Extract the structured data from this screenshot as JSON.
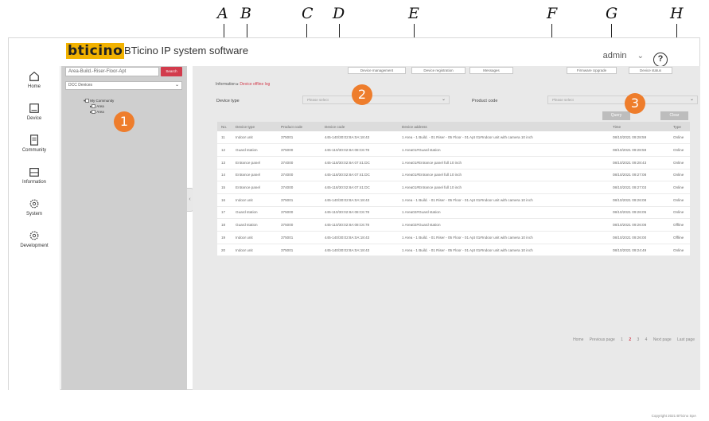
{
  "callouts": {
    "letters": [
      "A",
      "B",
      "C",
      "D",
      "E",
      "F",
      "G",
      "H"
    ],
    "badges": [
      "1",
      "2",
      "3"
    ]
  },
  "header": {
    "logo": "bticino",
    "app_title": "BTicino IP system software",
    "user": "admin",
    "help": "?"
  },
  "nav": [
    {
      "label": "Home",
      "icon": "home-icon"
    },
    {
      "label": "Device",
      "icon": "device-icon"
    },
    {
      "label": "Community",
      "icon": "community-icon"
    },
    {
      "label": "Information",
      "icon": "information-icon"
    },
    {
      "label": "System",
      "icon": "gear-icon"
    },
    {
      "label": "Development",
      "icon": "gear-icon"
    }
  ],
  "tree": {
    "search_placeholder": "Area-Build.-Riser-Floor-Apt",
    "search_button": "Search",
    "filter_value": "DCC Devices",
    "root": "My Community",
    "children": [
      "Area",
      "Area"
    ]
  },
  "toolbar": {
    "buttons": [
      "Device management",
      "Device registration",
      "Messages",
      "Firmware Upgrade",
      "Device status"
    ]
  },
  "breadcrumb": {
    "parent": "Information",
    "current": "Device offline log"
  },
  "filters": {
    "device_type_label": "Device type",
    "device_type_placeholder": "Please select",
    "product_code_label": "Product code",
    "product_code_placeholder": "Please select",
    "query_button": "Query",
    "clear_button": "Clear"
  },
  "table": {
    "columns": [
      "No.",
      "Device type",
      "Product code",
      "Device code",
      "Device address",
      "Time",
      "Type"
    ],
    "rows": [
      [
        "11",
        "Indoor unit",
        "375001",
        "445-140/30:02:8A:0A:18:43",
        "1 Area - 1 Build. - 01 Riser - 05 Floor - 01 Apt 01#Indoor unit with camera 10 inch",
        "08/10/2021 09:28:59",
        "Online"
      ],
      [
        "12",
        "Guard station",
        "375000",
        "445-110/30:02:8A:08:C6:78",
        "1 Area01#Guard station",
        "08/10/2021 09:28:59",
        "Online"
      ],
      [
        "13",
        "Entrance panel",
        "374000",
        "445-118/30:02:8A:07:41:DC",
        "1 Area01#Entrance panel full 10 inch",
        "08/10/2021 09:28:43",
        "Online"
      ],
      [
        "14",
        "Entrance panel",
        "374000",
        "445-118/30:02:8A:07:41:DC",
        "1 Area01#Entrance panel full 10 inch",
        "08/10/2021 09:27:08",
        "Online"
      ],
      [
        "15",
        "Entrance panel",
        "374000",
        "445-118/30:02:8A:07:41:DC",
        "1 Area01#Entrance panel full 10 inch",
        "08/10/2021 09:27:03",
        "Online"
      ],
      [
        "16",
        "Indoor unit",
        "375001",
        "445-140/30:02:8A:0A:18:43",
        "1 Area - 1 Build. - 01 Riser - 05 Floor - 01 Apt 01#Indoor unit with camera 10 inch",
        "08/10/2021 09:26:08",
        "Online"
      ],
      [
        "17",
        "Guard station",
        "375000",
        "445-110/30:02:8A:08:C6:78",
        "1 Area02#Guard station",
        "08/10/2021 09:26:05",
        "Online"
      ],
      [
        "18",
        "Guard station",
        "375000",
        "445-110/30:02:8A:08:C6:78",
        "1 Area02#Guard station",
        "08/10/2021 09:26:08",
        "Offline"
      ],
      [
        "19",
        "Indoor unit",
        "375001",
        "445-140/30:02:8A:0A:18:43",
        "1 Area - 1 Build. - 01 Riser - 05 Floor - 01 Apt 01#Indoor unit with camera 10 inch",
        "08/10/2021 09:26:00",
        "Offline"
      ],
      [
        "20",
        "Indoor unit",
        "375001",
        "445-140/30:02:8A:0A:18:43",
        "1 Area - 1 Build. - 01 Riser - 05 Floor - 01 Apt 01#Indoor unit with camera 10 inch",
        "08/10/2021 09:24:49",
        "Online"
      ]
    ]
  },
  "pager": {
    "home": "Home",
    "previous": "Previous page",
    "pages": [
      "1",
      "2",
      "3",
      "4"
    ],
    "current_page": "2",
    "next": "Next page",
    "last": "Last page"
  },
  "footer": {
    "copyright": "Copyright 2021 BTicino SpA"
  },
  "colors": {
    "accent": "#d23b4c",
    "badge": "#ee7d2c",
    "content_bg": "#e9e9e9",
    "tree_bg": "#cfcfcf"
  }
}
